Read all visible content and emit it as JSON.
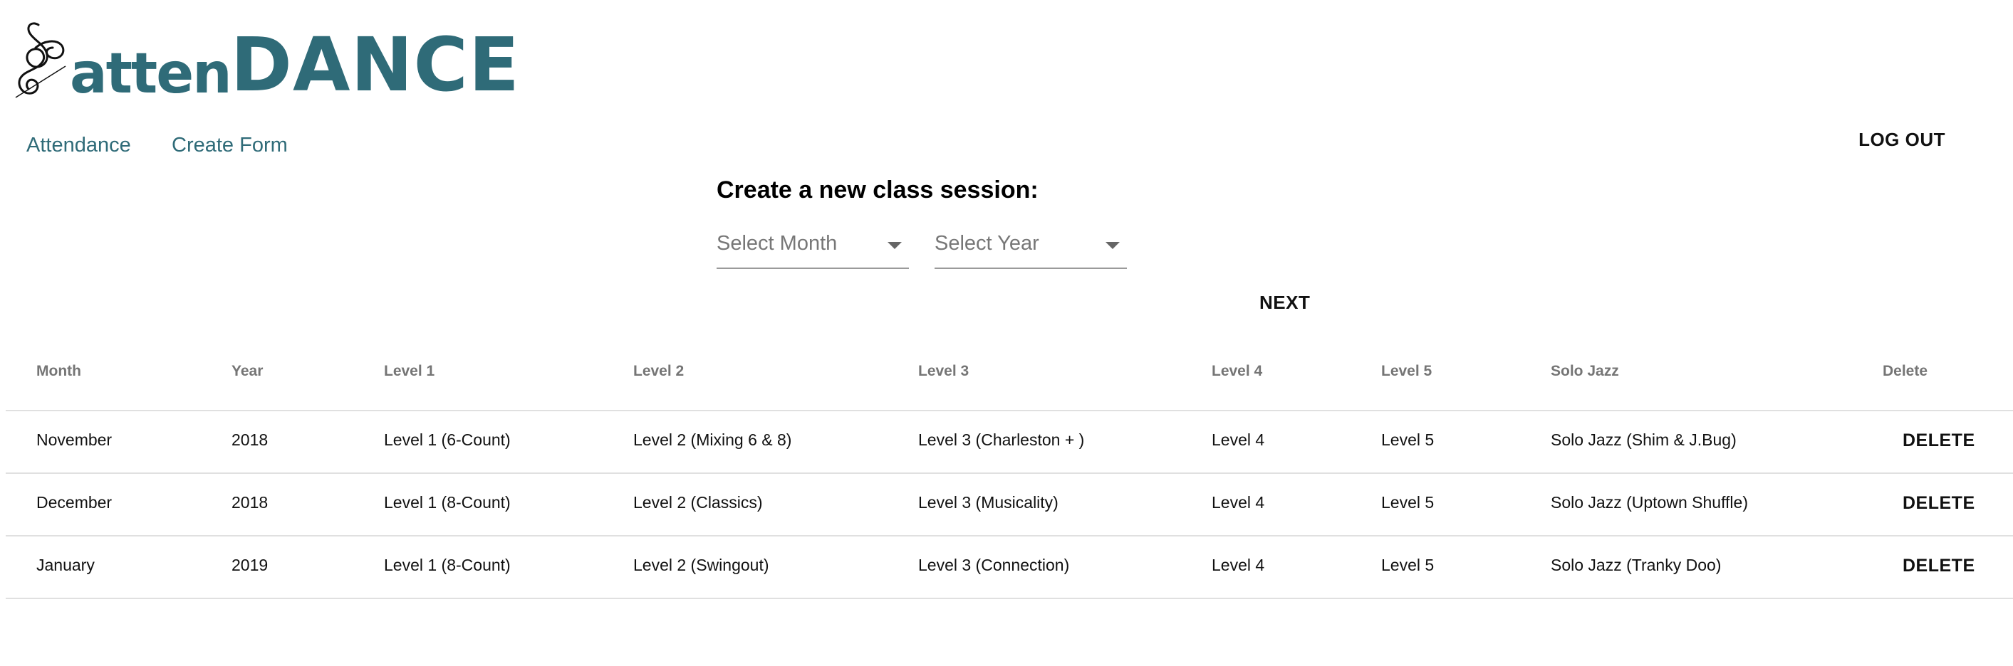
{
  "logo": {
    "icon": "treble-clef-ornament-icon",
    "part1": "atten",
    "part2": "DANCE",
    "color": "#2f6b78"
  },
  "nav": {
    "attendance": "Attendance",
    "create_form": "Create Form",
    "logout": "LOG OUT"
  },
  "form": {
    "title": "Create a new class session:",
    "month_placeholder": "Select Month",
    "year_placeholder": "Select Year",
    "next": "NEXT"
  },
  "table": {
    "headers": [
      "Month",
      "Year",
      "Level 1",
      "Level 2",
      "Level 3",
      "Level 4",
      "Level 5",
      "Solo Jazz",
      "Delete"
    ],
    "rows": [
      {
        "month": "November",
        "year": "2018",
        "l1": "Level 1 (6-Count)",
        "l2": "Level 2 (Mixing 6 & 8)",
        "l3": "Level 3 (Charleston + )",
        "l4": "Level 4",
        "l5": "Level 5",
        "solo": "Solo Jazz (Shim & J.Bug)",
        "delete": "DELETE"
      },
      {
        "month": "December",
        "year": "2018",
        "l1": "Level 1 (8-Count)",
        "l2": "Level 2 (Classics)",
        "l3": "Level 3 (Musicality)",
        "l4": "Level 4",
        "l5": "Level 5",
        "solo": "Solo Jazz (Uptown Shuffle)",
        "delete": "DELETE"
      },
      {
        "month": "January",
        "year": "2019",
        "l1": "Level 1 (8-Count)",
        "l2": "Level 2 (Swingout)",
        "l3": "Level 3 (Connection)",
        "l4": "Level 4",
        "l5": "Level 5",
        "solo": "Solo Jazz (Tranky Doo)",
        "delete": "DELETE"
      }
    ]
  }
}
